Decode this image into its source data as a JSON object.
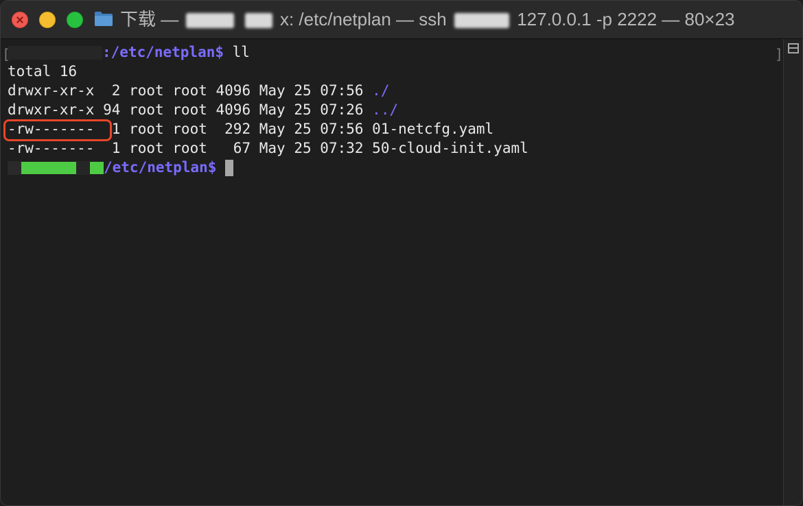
{
  "window": {
    "title_prefix": "下载 —",
    "title_middle": "x: /etc/netplan — ssh",
    "title_suffix": "127.0.0.1 -p 2222 — 80×23"
  },
  "terminal": {
    "prompt_path": ":/etc/netplan$",
    "command": " ll",
    "total": "total 16",
    "entries": [
      {
        "perms": "drwxr-xr-x",
        "links": " 2",
        "owner": "root",
        "group": "root",
        "size": "4096",
        "month": "May",
        "day": "25",
        "time": "07:56",
        "name": "./",
        "is_dir": true
      },
      {
        "perms": "drwxr-xr-x",
        "links": "94",
        "owner": "root",
        "group": "root",
        "size": "4096",
        "month": "May",
        "day": "25",
        "time": "07:26",
        "name": "../",
        "is_dir": true
      },
      {
        "perms": "-rw-------",
        "links": " 1",
        "owner": "root",
        "group": "root",
        "size": " 292",
        "month": "May",
        "day": "25",
        "time": "07:56",
        "name": "01-netcfg.yaml",
        "is_dir": false
      },
      {
        "perms": "-rw-------",
        "links": " 1",
        "owner": "root",
        "group": "root",
        "size": "  67",
        "month": "May",
        "day": "25",
        "time": "07:32",
        "name": "50-cloud-init.yaml",
        "is_dir": false
      }
    ],
    "prompt2_path": "/etc/netplan$"
  },
  "colors": {
    "path": "#7a6cff",
    "highlight": "#e8462a",
    "redaction": "#4ecb45"
  },
  "icons": [
    "close-icon",
    "minimize-icon",
    "maximize-icon",
    "folder-icon",
    "split-pane-icon"
  ]
}
